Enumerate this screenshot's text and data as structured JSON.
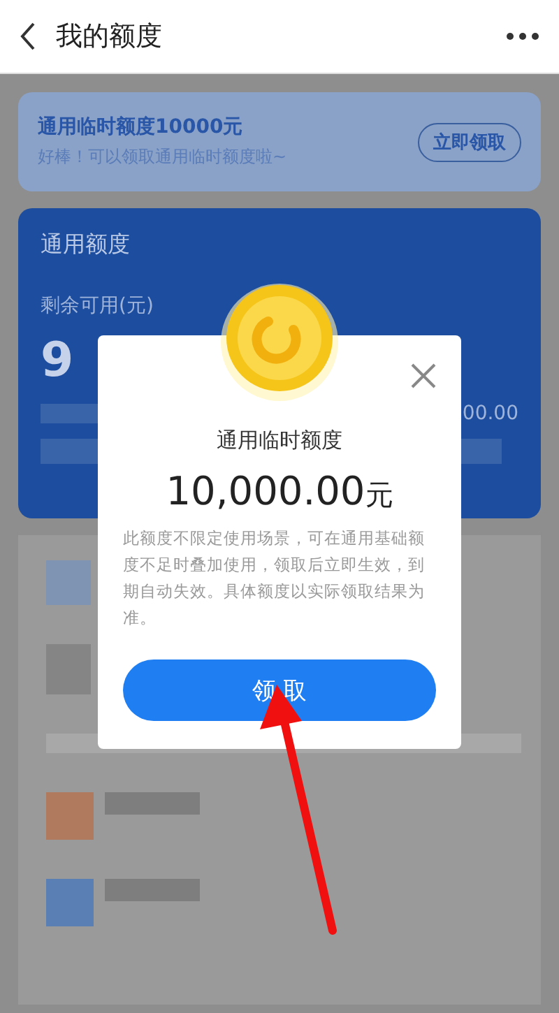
{
  "header": {
    "title": "我的额度"
  },
  "banner": {
    "title": "通用临时额度10000元",
    "subtitle": "好棒！可以领取通用临时额度啦~",
    "button": "立即领取"
  },
  "quota_card": {
    "title": "通用额度",
    "remaining_label": "剩余可用(元)",
    "remaining_value": "9",
    "total_value": "00.00"
  },
  "modal": {
    "title": "通用临时额度",
    "amount": "10,000.00",
    "unit": "元",
    "description": "此额度不限定使用场景，可在通用基础额度不足时叠加使用，领取后立即生效，到期自动失效。具体额度以实际领取结果为准。",
    "button": "领 取"
  }
}
